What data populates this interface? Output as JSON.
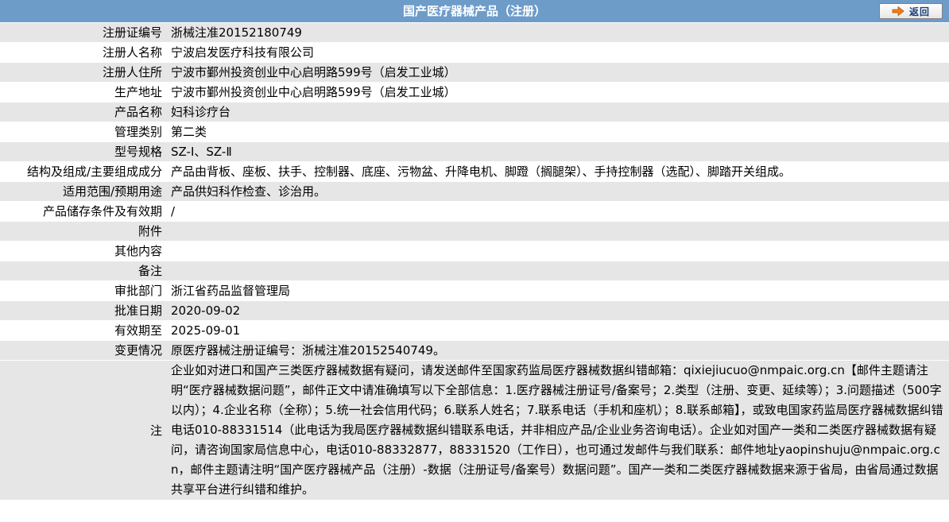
{
  "header": {
    "title": "国产医疗器械产品（注册）",
    "back_label": "返回",
    "back_icon": "arrow-right-icon",
    "accent_color": "#6e9cc9",
    "arrow_color": "#f07c1a"
  },
  "rows": [
    {
      "label": "注册证编号",
      "value": "浙械注准20152180749"
    },
    {
      "label": "注册人名称",
      "value": "宁波启发医疗科技有限公司"
    },
    {
      "label": "注册人住所",
      "value": "宁波市鄞州投资创业中心启明路599号（启发工业城）"
    },
    {
      "label": "生产地址",
      "value": "宁波市鄞州投资创业中心启明路599号（启发工业城）"
    },
    {
      "label": "产品名称",
      "value": "妇科诊疗台"
    },
    {
      "label": "管理类别",
      "value": "第二类"
    },
    {
      "label": "型号规格",
      "value": "SZ-Ⅰ、SZ-Ⅱ"
    },
    {
      "label": "结构及组成/主要组成成分",
      "value": "产品由背板、座板、扶手、控制器、底座、污物盆、升降电机、脚蹬（搁腿架）、手持控制器（选配）、脚踏开关组成。"
    },
    {
      "label": "适用范围/预期用途",
      "value": "产品供妇科作检查、诊治用。"
    },
    {
      "label": "产品储存条件及有效期",
      "value": "/"
    },
    {
      "label": "附件",
      "value": ""
    },
    {
      "label": "其他内容",
      "value": ""
    },
    {
      "label": "备注",
      "value": ""
    },
    {
      "label": "审批部门",
      "value": "浙江省药品监督管理局"
    },
    {
      "label": "批准日期",
      "value": "2020-09-02"
    },
    {
      "label": "有效期至",
      "value": "2025-09-01"
    },
    {
      "label": "变更情况",
      "value": "原医疗器械注册证编号：浙械注准20152540749。"
    }
  ],
  "note": {
    "label": "注",
    "text": "企业如对进口和国产三类医疗器械数据有疑问，请发送邮件至国家药监局医疗器械数据纠错邮箱：qixiejiucuo@nmpaic.org.cn【邮件主题请注明“医疗器械数据问题”，邮件正文中请准确填写以下全部信息：1.医疗器械注册证号/备案号；2.类型（注册、变更、延续等）；3.问题描述（500字以内）；4.企业名称（全称）；5.统一社会信用代码；6.联系人姓名；7.联系电话（手机和座机）；8.联系邮箱】，或致电国家药监局医疗器械数据纠错电话010-88331514（此电话为我局医疗器械数据纠错联系电话，并非相应产品/企业业务咨询电话）。企业如对国产一类和二类医疗器械数据有疑问，请咨询国家局信息中心，电话010-88332877，88331520（工作日），也可通过发邮件与我们联系：邮件地址yaopinshuju@nmpaic.org.cn，邮件主题请注明“国产医疗器械产品（注册）-数据（注册证号/备案号）数据问题”。国产一类和二类医疗器械数据来源于省局，由省局通过数据共享平台进行纠错和维护。"
  }
}
